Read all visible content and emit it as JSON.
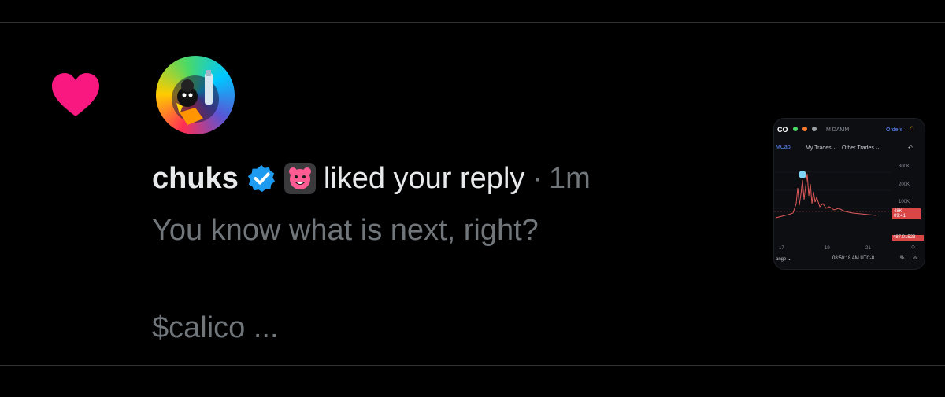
{
  "notification": {
    "user_name": "chuks",
    "action": "liked your reply",
    "separator": "·",
    "time": "1m",
    "reply_line1": "You know what is next, right?",
    "reply_line2": "$calico ..."
  },
  "icons": {
    "heart": "heart-icon",
    "verified": "verified-badge-icon",
    "affiliate": "bear-affiliate-icon"
  },
  "thumbnail": {
    "ticker": "CO",
    "pool": "M DAMM",
    "orders": "Orders",
    "mcap": "MCap",
    "my_trades": "My Trades ⌄",
    "other_trades": "Other Trades ⌄",
    "y_300": "300K",
    "y_200": "200K",
    "y_100": "100K",
    "price_tag1": "48K",
    "price_tag2": "09:41",
    "price_tag3": "487.01523",
    "x_17": "17",
    "x_19": "19",
    "x_21": "21",
    "range": "ange ⌄",
    "clock": "08:50:18 AM UTC-8",
    "pct": "%",
    "lo": "lo"
  },
  "colors": {
    "heart": "#f91880",
    "verified": "#1d9bf0",
    "bear": "#ff5c93",
    "muted_text": "#71767b",
    "chart_line": "#e05a5a"
  }
}
